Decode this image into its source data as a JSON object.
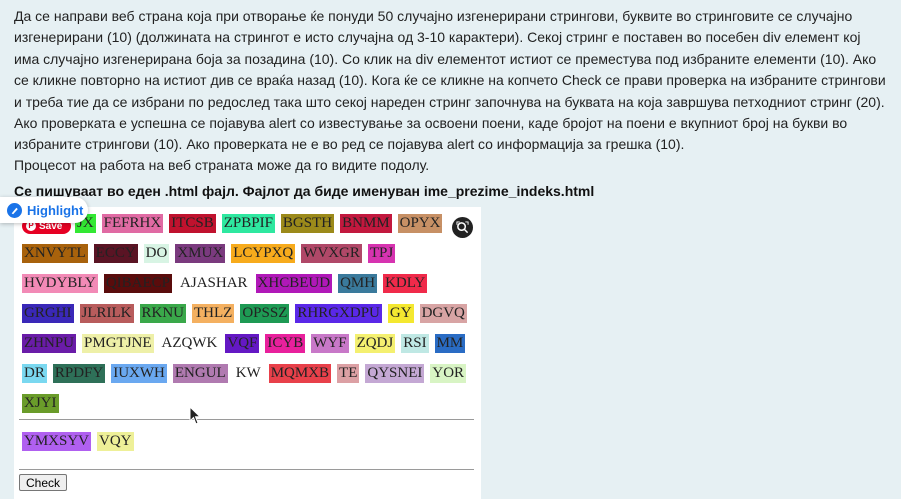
{
  "description": {
    "line1": "Да се направи веб страна која при отворање ќе понуди 50 случајно изгенерирани стрингови, буквите во стринговите се случајно изгенерирани (10) (должината на стрингот е исто случајна од 3-10 карактери). Секој стринг е поставен во посебен div елемент кој има случајно изгенерирана боја за позадина (10). Со клик на div елементот истиот се преместува под избраните елементи (10). Ако се кликне повторно на истиот див се враќа назад (10). Кога ќе се кликне на копчето Check се прави проверка на избраните стрингови и треба тие да се избрани по редослед така што секој нареден стринг започнува на буквата на која завршува петходниот стринг (20). Ако проверката е успешна се појавува alert со известување за освоени поени, каде бројот на поени е вкупниот број на букви во избраните стрингови (10). Ако проверката не е во ред се појавува alert со информација за грешка (10).",
    "line2": "Процесот на работа на веб страната може да го видите подолу.",
    "bold": "Се пишуваат во еден .html фајл. Фајлот да биде именуван ime_prezime_indeks.html"
  },
  "highlight": {
    "label": "Highlight"
  },
  "save_badge": {
    "label": "Save"
  },
  "items": [
    {
      "text": "JX",
      "bg": "#33e833",
      "fg": "#222"
    },
    {
      "text": "FEFRHX",
      "bg": "#e06aa3",
      "fg": "#222"
    },
    {
      "text": "ITCSB",
      "bg": "#c0122e",
      "fg": "#222"
    },
    {
      "text": "ZPBPIF",
      "bg": "#2ee8a0",
      "fg": "#222"
    },
    {
      "text": "BGSTH",
      "bg": "#9c8a1a",
      "fg": "#222"
    },
    {
      "text": "BNMM",
      "bg": "#c2183e",
      "fg": "#222"
    },
    {
      "text": "OPYX",
      "bg": "#c79065",
      "fg": "#222"
    },
    {
      "text": "XNVYTL",
      "bg": "#a8620c",
      "fg": "#222"
    },
    {
      "text": "ECCY",
      "bg": "#5a1424",
      "fg": "#222"
    },
    {
      "text": "DO",
      "bg": "#d8f4e4",
      "fg": "#222"
    },
    {
      "text": "XMUX",
      "bg": "#7a3a7e",
      "fg": "#222"
    },
    {
      "text": "LCYPXQ",
      "bg": "#f7ab1c",
      "fg": "#222"
    },
    {
      "text": "WVXGR",
      "bg": "#b04868",
      "fg": "#222"
    },
    {
      "text": "TPJ",
      "bg": "#d633b0",
      "fg": "#222"
    },
    {
      "text": "HVDYBLY",
      "bg": "#f28ab6",
      "fg": "#222"
    },
    {
      "text": "QIBAECP",
      "bg": "#5a0c0c",
      "fg": "#222"
    },
    {
      "text": "AJASHAR",
      "bg": "#ffffff",
      "fg": "#222"
    },
    {
      "text": "XHCBEUD",
      "bg": "#b018b8",
      "fg": "#222"
    },
    {
      "text": "QMH",
      "bg": "#3a7a9c",
      "fg": "#222"
    },
    {
      "text": "KDLY",
      "bg": "#f02a4a",
      "fg": "#222"
    },
    {
      "text": "GRGHI",
      "bg": "#3a28b8",
      "fg": "#222"
    },
    {
      "text": "JLRILK",
      "bg": "#b85c5c",
      "fg": "#222"
    },
    {
      "text": "RKNU",
      "bg": "#3aa84a",
      "fg": "#222"
    },
    {
      "text": "THLZ",
      "bg": "#f4b060",
      "fg": "#222"
    },
    {
      "text": "OPSSZ",
      "bg": "#1e9a54",
      "fg": "#222"
    },
    {
      "text": "RHRGXDPU",
      "bg": "#5a28e8",
      "fg": "#222"
    },
    {
      "text": "GY",
      "bg": "#f4e830",
      "fg": "#222"
    },
    {
      "text": "DGVQ",
      "bg": "#d8a4a4",
      "fg": "#222"
    },
    {
      "text": "ZHNPU",
      "bg": "#6a1ca8",
      "fg": "#222"
    },
    {
      "text": "PMGTJNE",
      "bg": "#eef0a8",
      "fg": "#222"
    },
    {
      "text": "AZQWK",
      "bg": "#ffffff",
      "fg": "#222"
    },
    {
      "text": "VQF",
      "bg": "#6418c4",
      "fg": "#222"
    },
    {
      "text": "ICYB",
      "bg": "#e8209c",
      "fg": "#222"
    },
    {
      "text": "WYF",
      "bg": "#c878c8",
      "fg": "#222"
    },
    {
      "text": "ZQDJ",
      "bg": "#f4f070",
      "fg": "#222"
    },
    {
      "text": "RSI",
      "bg": "#bfe8e4",
      "fg": "#222"
    },
    {
      "text": "MM",
      "bg": "#2a6cc4",
      "fg": "#222"
    },
    {
      "text": "DR",
      "bg": "#7ad8f0",
      "fg": "#222"
    },
    {
      "text": "RPDFY",
      "bg": "#2e7058",
      "fg": "#222"
    },
    {
      "text": "IUXWH",
      "bg": "#6aa8f0",
      "fg": "#222"
    },
    {
      "text": "ENGUL",
      "bg": "#b07ab0",
      "fg": "#222"
    },
    {
      "text": "KW",
      "bg": "#ffffff",
      "fg": "#222"
    },
    {
      "text": "MQMXB",
      "bg": "#e8404a",
      "fg": "#222"
    },
    {
      "text": "TE",
      "bg": "#dca0a4",
      "fg": "#222"
    },
    {
      "text": "QYSNEI",
      "bg": "#c4a8d4",
      "fg": "#222"
    },
    {
      "text": "YOR",
      "bg": "#d8f4c4",
      "fg": "#222"
    },
    {
      "text": "XJYI",
      "bg": "#6a9c2a",
      "fg": "#222"
    }
  ],
  "selected": [
    {
      "text": "YMXSYV",
      "bg": "#b060f0",
      "fg": "#222"
    },
    {
      "text": "VQY",
      "bg": "#eef098",
      "fg": "#222"
    }
  ],
  "check_button": {
    "label": "Check"
  },
  "colors": {
    "page_bg": "#e6f0f3",
    "frame_bg": "#ffffff",
    "accent": "#1a73e8",
    "pin": "#e60023"
  }
}
